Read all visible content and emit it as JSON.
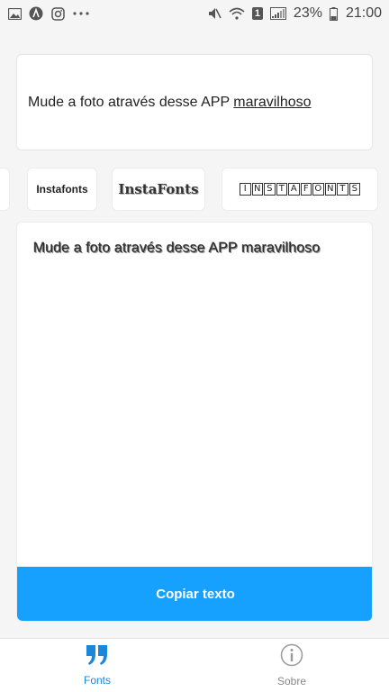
{
  "status_bar": {
    "battery_percent": "23%",
    "time": "21:00",
    "notification_icons": [
      "image-icon",
      "a-logo-icon",
      "instagram-icon",
      "more-dots-icon"
    ],
    "system_icons": [
      "mute-icon",
      "wifi-icon",
      "sim-1-icon",
      "signal-icon",
      "battery-icon"
    ],
    "sim_label": "1"
  },
  "input": {
    "text_plain": "Mude a foto através desse APP ",
    "text_underlined": "maravilhoso"
  },
  "font_chips": [
    {
      "label": ""
    },
    {
      "label": "Instafonts"
    },
    {
      "label": "InstaFonts"
    },
    {
      "label": "INSTAFONTS"
    }
  ],
  "output": {
    "text": "Mude a foto através desse APP maravilhoso"
  },
  "copy_button": {
    "label": "Copiar texto"
  },
  "nav": {
    "items": [
      {
        "label": "Fonts",
        "icon": "quote-icon",
        "active": true
      },
      {
        "label": "Sobre",
        "icon": "info-icon",
        "active": false
      }
    ]
  },
  "colors": {
    "accent": "#16a0ff",
    "nav_active": "#1c86d8",
    "background": "#f5f5f5"
  }
}
